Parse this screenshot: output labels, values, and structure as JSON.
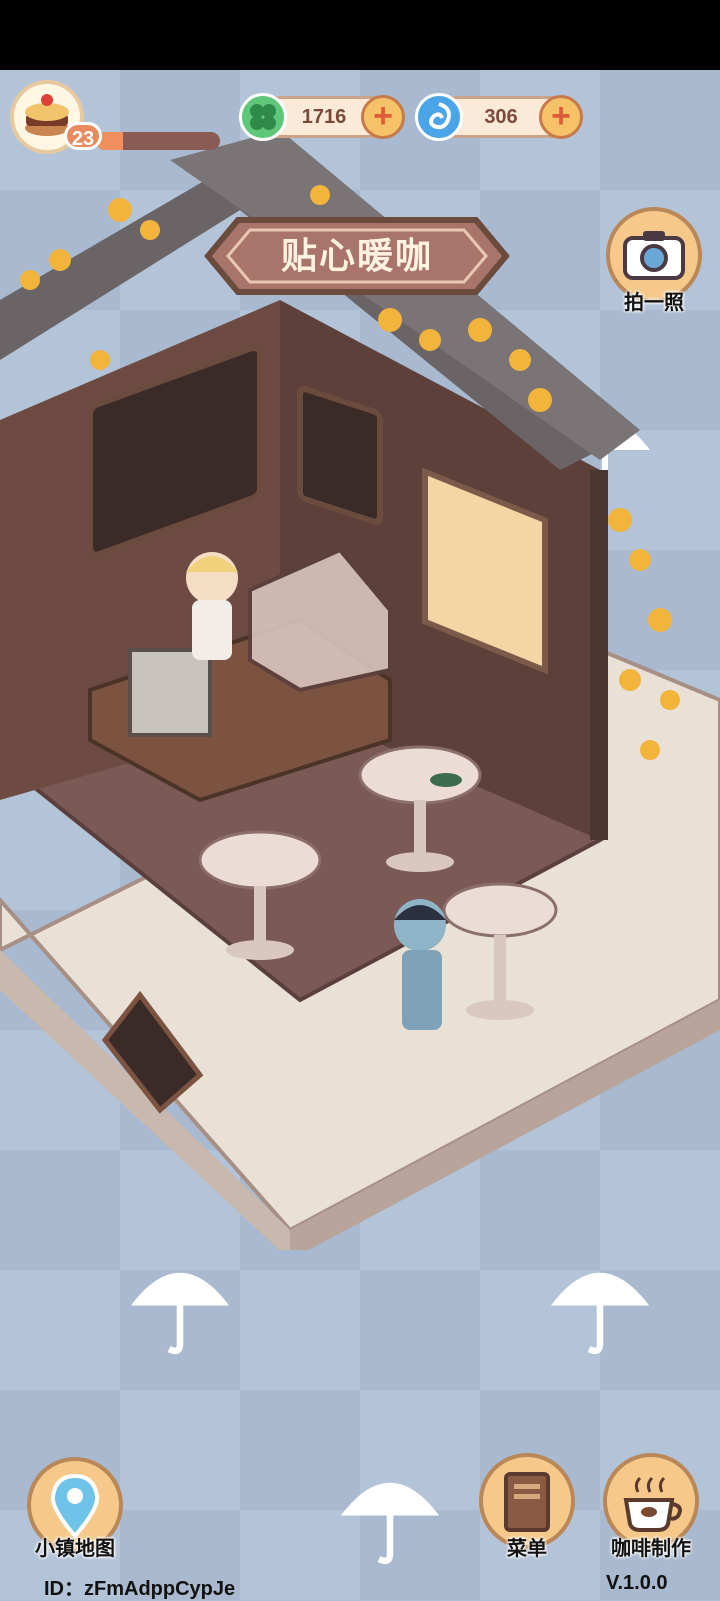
{
  "hud": {
    "level": "23",
    "xp_progress": 0.22,
    "clover_count": "1716",
    "gem_count": "306",
    "plus_symbol": "+"
  },
  "scene": {
    "shop_sign": "贴心暖咖"
  },
  "buttons": {
    "photo_label": "拍一照",
    "map_label": "小镇地图",
    "menu_label": "菜单",
    "coffee_label": "咖啡制作"
  },
  "footer": {
    "player_id": "ID：zFmAdppCypJe",
    "version": "V.1.0.0"
  },
  "colors": {
    "background": "#b3c3d8",
    "wood": "#6b4b3e",
    "accent_orange": "#f08f5b",
    "clover_green": "#5fc77a",
    "gem_blue": "#4aa4e8"
  },
  "icons": [
    "cake-icon",
    "clover-icon",
    "gem-icon",
    "plus-icon",
    "camera-icon",
    "map-pin-icon",
    "menu-book-icon",
    "coffee-cup-icon",
    "umbrella-icon"
  ]
}
